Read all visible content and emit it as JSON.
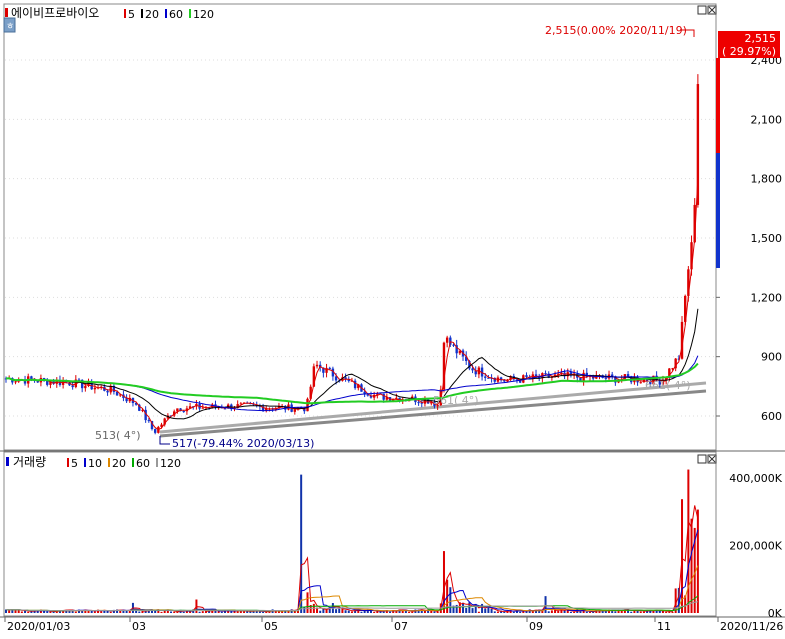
{
  "price_panel": {
    "stock_name": "에이비프로바이오",
    "ma_legend": [
      {
        "label": "5",
        "color": "#dd0000"
      },
      {
        "label": "20",
        "color": "#000000"
      },
      {
        "label": "60",
        "color": "#0000cc"
      },
      {
        "label": "120",
        "color": "#22cc22"
      }
    ],
    "current_price": "2,515",
    "current_change": "( 29.97%)",
    "high_annotation": "2,515(0.00% 2020/11/19)",
    "low_annotation": "517(-79.44% 2020/03/13)",
    "trend_annotation_left": "513( 4°)",
    "trend_annotation_mid": "561( 4°)",
    "trend_annotation_right": "661( 4°)",
    "y_ticks": [
      "2,400",
      "2,100",
      "1,800",
      "1,500",
      "1,200",
      "900",
      "600"
    ]
  },
  "volume_panel": {
    "title": "거래량",
    "ma_legend": [
      {
        "label": "5",
        "color": "#dd0000"
      },
      {
        "label": "10",
        "color": "#0000cc"
      },
      {
        "label": "20",
        "color": "#dd8800"
      },
      {
        "label": "60",
        "color": "#00aa00"
      },
      {
        "label": "120",
        "color": "#999999"
      }
    ],
    "y_ticks": [
      "400,000K",
      "200,000K",
      "0K"
    ]
  },
  "x_axis_labels": [
    "2020/01/03",
    "03",
    "05",
    "07",
    "09",
    "11",
    "2020/11/26"
  ],
  "chart_data": [
    {
      "type": "candlestick",
      "title": "에이비프로바이오",
      "y_axis": {
        "ticks": [
          600,
          900,
          1200,
          1500,
          1800,
          2100,
          2400
        ],
        "range": [
          480,
          2580
        ]
      },
      "x_range": [
        "2020/01/03",
        "2020/11/26"
      ],
      "price_series_close": {
        "dates": [
          "2020/01",
          "2020/02",
          "2020/03/13",
          "2020/04",
          "2020/05",
          "2020/06",
          "2020/07",
          "2020/08",
          "2020/09",
          "2020/10",
          "2020/11/05",
          "2020/11/12",
          "2020/11/17",
          "2020/11/19",
          "2020/11/26"
        ],
        "values": [
          790,
          720,
          517,
          650,
          640,
          820,
          680,
          1000,
          780,
          790,
          780,
          1100,
          1500,
          2515,
          2515
        ]
      },
      "moving_averages": [
        {
          "name": "5",
          "color": "#dd0000"
        },
        {
          "name": "20",
          "color": "#000000"
        },
        {
          "name": "60",
          "color": "#0000cc"
        },
        {
          "name": "120",
          "color": "#22cc22"
        }
      ],
      "annotations": [
        {
          "text": "2,515(0.00% 2020/11/19)",
          "value": 2515,
          "date": "2020/11/19"
        },
        {
          "text": "517(-79.44% 2020/03/13)",
          "value": 517,
          "date": "2020/03/13"
        }
      ],
      "last_price": 2515,
      "last_change_pct": 29.97
    },
    {
      "type": "bar",
      "title": "거래량",
      "y_axis": {
        "ticks": [
          "0K",
          "200,000K",
          "400,000K"
        ],
        "range": [
          0,
          460000
        ],
        "unit": "K"
      },
      "spikes": [
        {
          "date": "2020/05/22",
          "value": 410000
        },
        {
          "date": "2020/07/14",
          "value": 180000
        },
        {
          "date": "2020/11/17",
          "value": 420000
        },
        {
          "date": "2020/11/19",
          "value": 290000
        }
      ]
    }
  ]
}
